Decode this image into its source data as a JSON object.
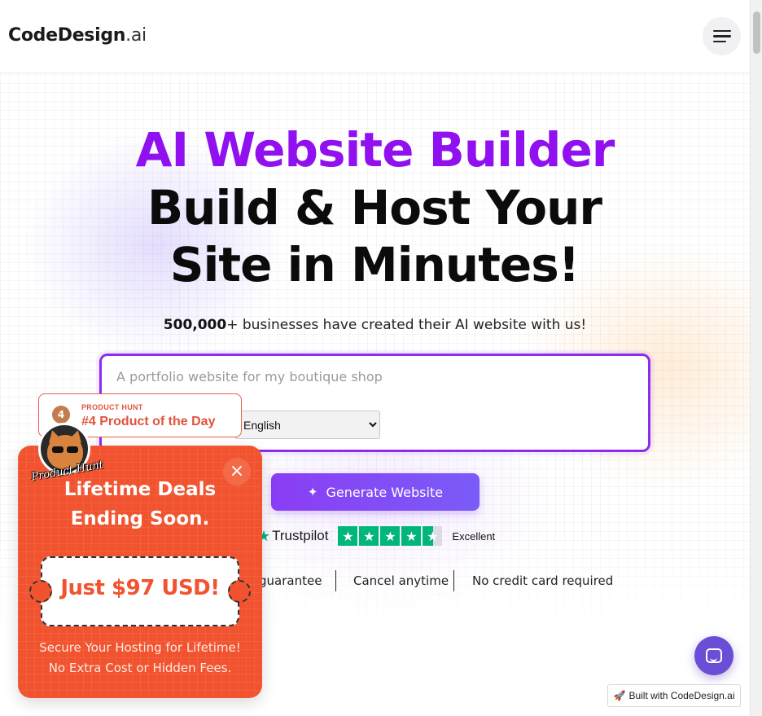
{
  "header": {
    "logo_main": "CodeDesign",
    "logo_suffix": ".ai",
    "menu_icon": "hamburger-menu-icon"
  },
  "hero": {
    "title_accent": "AI Website Builder",
    "title_main": "Build & Host Your Site in Minutes!",
    "subtitle_count": "500,000",
    "subtitle_rest": "+ businesses have created their AI website with us!",
    "prompt_placeholder": "A portfolio website for my boutique shop",
    "language_selected": "English",
    "generate_label": "Generate Website",
    "generate_icon": "sparkle-icon"
  },
  "trustpilot": {
    "brand": "Trustpilot",
    "rating_stars": 4.5,
    "rating_text": "Excellent"
  },
  "features": {
    "item1": "guarantee",
    "item2": "Cancel anytime",
    "item3": "No credit card required"
  },
  "product_hunt": {
    "rank": "4",
    "small_label": "PRODUCT HUNT",
    "big_label": "#4 Product of the Day"
  },
  "promo": {
    "close_symbol": "×",
    "heading_line1": "Lifetime Deals",
    "heading_line2": "Ending Soon.",
    "price": "Just $97 USD!",
    "note_line1": "Secure Your Hosting for Lifetime!",
    "note_line2": "No Extra Cost or Hidden Fees.",
    "mascot_text": "Product Hunt",
    "color": "#f1532f"
  },
  "chat": {
    "icon": "chat-icon"
  },
  "built_with": {
    "emoji": "🚀",
    "label": "Built with CodeDesign.ai"
  },
  "colors": {
    "accent_purple": "#9010f0",
    "button_purple": "#8b3df5",
    "trustpilot_green": "#00b67a",
    "promo_orange": "#f1532f"
  }
}
